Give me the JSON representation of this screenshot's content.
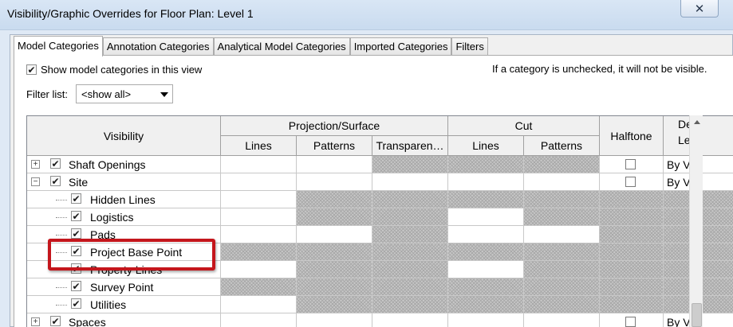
{
  "window": {
    "title": "Visibility/Graphic Overrides for Floor Plan: Level 1",
    "close_glyph": "✕"
  },
  "tabs": [
    {
      "label": "Model Categories",
      "active": true
    },
    {
      "label": "Annotation Categories",
      "active": false
    },
    {
      "label": "Analytical Model Categories",
      "active": false
    },
    {
      "label": "Imported Categories",
      "active": false
    },
    {
      "label": "Filters",
      "active": false
    }
  ],
  "options": {
    "show_model_categories_label": "Show model categories in this view",
    "show_model_categories_checked": true,
    "hint": "If a category is unchecked, it will not be visible.",
    "filter_label": "Filter list:",
    "filter_value": "<show all>"
  },
  "table": {
    "headers": {
      "visibility": "Visibility",
      "projection_surface": "Projection/Surface",
      "cut": "Cut",
      "halftone": "Halftone",
      "detail_level_partial_1": "De",
      "detail_level_partial_2": "Le",
      "lines": "Lines",
      "patterns": "Patterns",
      "transparency": "Transparen…",
      "cut_lines": "Lines",
      "cut_patterns": "Patterns"
    },
    "rows": [
      {
        "label": "Shaft Openings",
        "level": 0,
        "expander": "+",
        "checked": true,
        "detail": "By V"
      },
      {
        "label": "Site",
        "level": 0,
        "expander": "−",
        "checked": true,
        "detail": "By V"
      },
      {
        "label": "Hidden Lines",
        "level": 1,
        "checked": true
      },
      {
        "label": "Logistics",
        "level": 1,
        "checked": true
      },
      {
        "label": "Pads",
        "level": 1,
        "checked": true
      },
      {
        "label": "Project Base Point",
        "level": 1,
        "checked": true
      },
      {
        "label": "Property Lines",
        "level": 1,
        "checked": true
      },
      {
        "label": "Survey Point",
        "level": 1,
        "checked": true
      },
      {
        "label": "Utilities",
        "level": 1,
        "checked": true
      },
      {
        "label": "Spaces",
        "level": 0,
        "expander": "+",
        "checked": true,
        "detail": "By V"
      }
    ],
    "check_glyph": "✔"
  },
  "colors": {
    "highlight_border": "#c4161c",
    "title_bar": "#d9e6f5",
    "panel_bg": "#f0f0f0"
  }
}
